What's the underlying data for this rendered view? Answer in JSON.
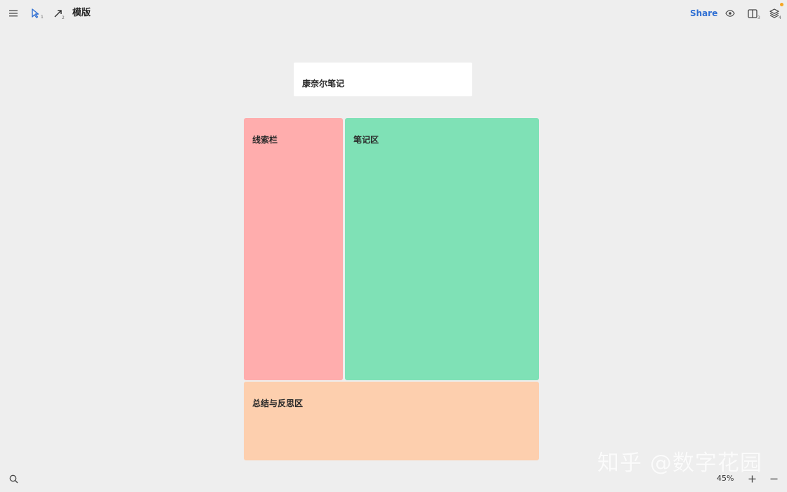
{
  "header": {
    "title": "模版",
    "share_label": "Share",
    "select_tool_shortcut": "1",
    "arrow_tool_shortcut": "2",
    "split_view_shortcut": "3",
    "layers_shortcut": "4"
  },
  "canvas": {
    "title_card": "康奈尔笔记",
    "cue_column": "线索栏",
    "notes_area": "笔记区",
    "summary_area": "总结与反思区"
  },
  "footer": {
    "zoom": "45%",
    "watermark": "知乎 @数字花园"
  },
  "colors": {
    "accent": "#2f6fd3",
    "cue": "#ffadad",
    "notes": "#7fe1b6",
    "summary": "#fdcfae",
    "notification_dot": "#f5a623"
  },
  "icons": {
    "menu": "menu-icon",
    "select": "cursor-icon",
    "arrow": "arrow-icon",
    "preview": "eye-icon",
    "split": "split-view-icon",
    "layers": "layers-icon",
    "search": "search-icon",
    "zoom_in": "plus-icon",
    "zoom_out": "minus-icon"
  }
}
